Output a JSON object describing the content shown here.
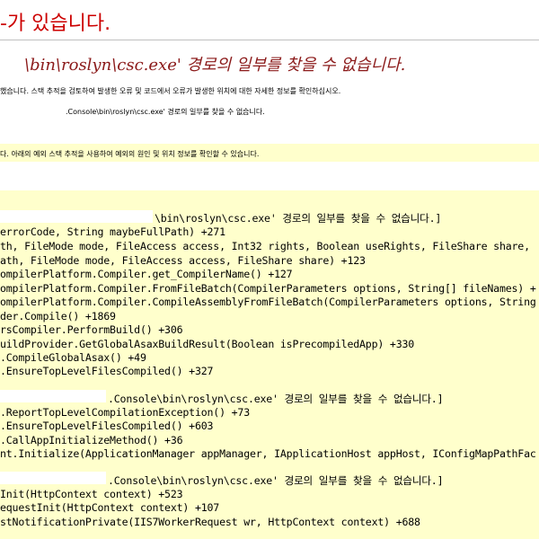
{
  "header": {
    "title": "-가 있습니다.",
    "subtitle": "\\bin\\roslyn\\csc.exe' 경로의 일부를 찾을 수 없습니다."
  },
  "description": {
    "line1": "했습니다. 스택 추적을 검토하여 발생한 오류 및 코드에서 오류가 발생한 위치에 대한 자세한 정보를 확인하십시오.",
    "line2": ".Console\\bin\\roslyn\\csc.exe' 경로의 일부를 찾을 수 없습니다."
  },
  "source_note": "다. 아래의 예외 스택 추적을 사용하여 예외의 원인 및 위치 정보를 확인할 수 있습니다.",
  "stack_trace": {
    "lines": [
      "\\bin\\roslyn\\csc.exe' 경로의 일부를 찾을 수 없습니다.]",
      "errorCode, String maybeFullPath) +271",
      "th, FileMode mode, FileAccess access, Int32 rights, Boolean useRights, FileShare share,",
      "ath, FileMode mode, FileAccess access, FileShare share) +123",
      "ompilerPlatform.Compiler.get_CompilerName() +127",
      "ompilerPlatform.Compiler.FromFileBatch(CompilerParameters options, String[] fileNames) +",
      "ompilerPlatform.Compiler.CompileAssemblyFromFileBatch(CompilerParameters options, String",
      "der.Compile() +1869",
      "rsCompiler.PerformBuild() +306",
      "uildProvider.GetGlobalAsaxBuildResult(Boolean isPrecompiledApp) +330",
      ".CompileGlobalAsax() +49",
      ".EnsureTopLevelFilesCompiled() +327",
      ".Console\\bin\\roslyn\\csc.exe' 경로의 일부를 찾을 수 없습니다.]",
      ".ReportTopLevelCompilationException() +73",
      ".EnsureTopLevelFilesCompiled() +603",
      ".CallAppInitializeMethod() +36",
      "nt.Initialize(ApplicationManager appManager, IApplicationHost appHost, IConfigMapPathFac",
      ".Console\\bin\\roslyn\\csc.exe' 경로의 일부를 찾을 수 없습니다.]",
      "Init(HttpContext context) +523",
      "equestInit(HttpContext context) +107",
      "stNotificationPrivate(IIS7WorkerRequest wr, HttpContext context) +688"
    ]
  }
}
